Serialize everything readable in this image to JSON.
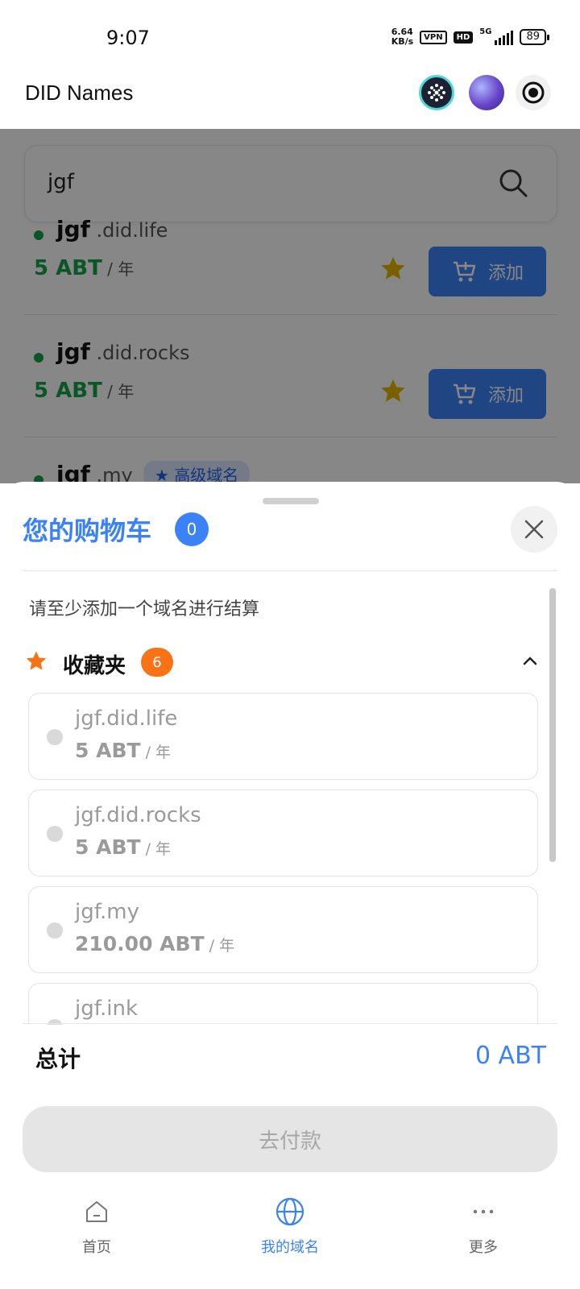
{
  "status_bar": {
    "time": "9:07",
    "net_speed_value": "6.64",
    "net_speed_unit": "KB/s",
    "vpn_label": "VPN",
    "hd_label": "HD",
    "network_label": "5G",
    "battery": "89"
  },
  "header": {
    "title": "DID Names"
  },
  "search": {
    "query": "jgf"
  },
  "results": [
    {
      "name": "jgf",
      "tld": " .did.life",
      "price": "5 ABT",
      "unit": " / 年",
      "add_label": "添加"
    },
    {
      "name": "jgf",
      "tld": " .did.rocks",
      "price": "5 ABT",
      "unit": " / 年",
      "add_label": "添加"
    },
    {
      "name": "jgf",
      "tld": " .my",
      "premium_label": "高级域名"
    }
  ],
  "cart": {
    "title": "您的购物车",
    "count": "0",
    "hint": "请至少添加一个域名进行结算",
    "favorites_title": "收藏夹",
    "favorites_count": "6",
    "favorites": [
      {
        "name": "jgf.did.life",
        "price": "5 ABT",
        "unit": " / 年"
      },
      {
        "name": "jgf.did.rocks",
        "price": "5 ABT",
        "unit": " / 年"
      },
      {
        "name": "jgf.my",
        "price": "210.00 ABT",
        "unit": " / 年"
      },
      {
        "name": "jgf.ink",
        "price": "",
        "unit": ""
      }
    ],
    "total_label": "总计",
    "total_value": "0 ABT",
    "pay_label": "去付款"
  },
  "nav": {
    "items": [
      {
        "label": "首页"
      },
      {
        "label": "我的域名"
      },
      {
        "label": "更多"
      }
    ]
  },
  "colors": {
    "accent": "#3b82f6",
    "price_green": "#16a34a",
    "favorite_orange": "#f97316",
    "star_gold": "#e6b400"
  }
}
